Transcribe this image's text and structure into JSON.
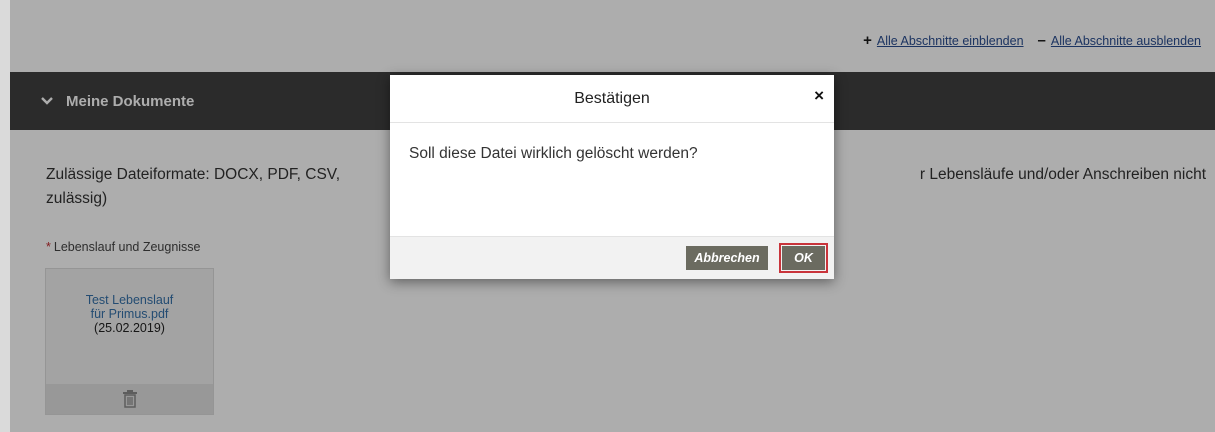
{
  "toolbar": {
    "expand_label": "Alle Abschnitte einblenden",
    "collapse_label": "Alle Abschnitte ausblenden",
    "expand_icon": "+",
    "collapse_icon": "–"
  },
  "section": {
    "title": "Meine Dokumente",
    "info_text": "Zulässige Dateiformate: DOCX, PDF, CSV, ... r Lebensläufe und/oder Anschreiben nicht zulässig)",
    "info_line1": "Zulässige Dateiformate: DOCX, PDF, CSV,",
    "info_line1_right": "r Lebensläufe und/oder Anschreiben nicht",
    "info_line2": "zulässig)",
    "field_required_mark": "*",
    "field_label": "Lebenslauf und Zeugnisse",
    "documents": [
      {
        "name_line1": "Test Lebenslauf",
        "name_line2": "für Primus.pdf",
        "date": "(25.02.2019)",
        "delete_icon": "trash-icon"
      }
    ]
  },
  "dialog": {
    "title": "Bestätigen",
    "message": "Soll diese Datei wirklich gelöscht werden?",
    "cancel_label": "Abbrechen",
    "ok_label": "OK",
    "close_icon": "×"
  },
  "colors": {
    "header_bg": "#404040",
    "link": "#2a4d8f",
    "doc_link": "#3571a9",
    "button_bg": "#6b6b60",
    "highlight": "#c9343b",
    "required": "#c0282d"
  }
}
